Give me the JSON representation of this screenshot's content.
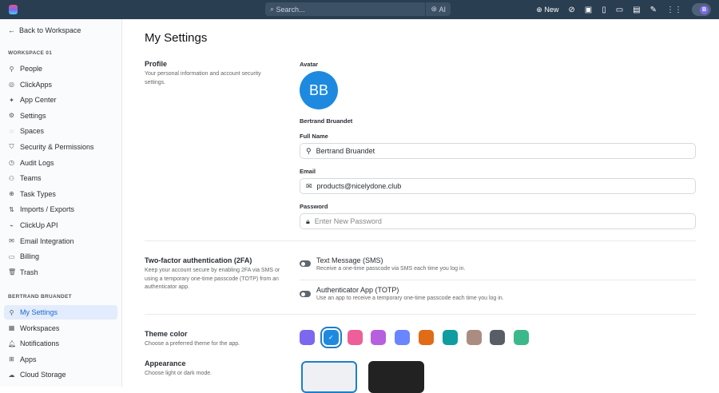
{
  "topbar": {
    "search_placeholder": "Search...",
    "ai_label": "AI",
    "new_label": "New",
    "avatar_initial": "B"
  },
  "sidebar": {
    "back": "Back to Workspace",
    "workspace_heading": "WORKSPACE 01",
    "workspace_items": [
      {
        "label": "People",
        "icon": "person-icon"
      },
      {
        "label": "ClickApps",
        "icon": "clickapps-icon"
      },
      {
        "label": "App Center",
        "icon": "app-center-icon"
      },
      {
        "label": "Settings",
        "icon": "gear-icon"
      },
      {
        "label": "Spaces",
        "icon": "spaces-icon"
      },
      {
        "label": "Security & Permissions",
        "icon": "shield-icon"
      },
      {
        "label": "Audit Logs",
        "icon": "audit-icon"
      },
      {
        "label": "Teams",
        "icon": "teams-icon"
      },
      {
        "label": "Task Types",
        "icon": "task-types-icon"
      },
      {
        "label": "Imports / Exports",
        "icon": "import-icon"
      },
      {
        "label": "ClickUp API",
        "icon": "api-icon"
      },
      {
        "label": "Email Integration",
        "icon": "email-icon"
      },
      {
        "label": "Billing",
        "icon": "billing-icon"
      },
      {
        "label": "Trash",
        "icon": "trash-icon"
      }
    ],
    "user_heading": "BERTRAND BRUANDET",
    "user_items": [
      {
        "label": "My Settings",
        "icon": "person-icon"
      },
      {
        "label": "Workspaces",
        "icon": "workspaces-icon"
      },
      {
        "label": "Notifications",
        "icon": "bell-icon"
      },
      {
        "label": "Apps",
        "icon": "apps-icon"
      },
      {
        "label": "Cloud Storage",
        "icon": "cloud-icon"
      }
    ]
  },
  "main": {
    "title": "My Settings",
    "profile": {
      "label": "Profile",
      "desc": "Your personal information and account security settings.",
      "avatar_label": "Avatar",
      "initials": "BB",
      "name": "Bertrand Bruandet",
      "full_name_label": "Full Name",
      "full_name": "Bertrand Bruandet",
      "email_label": "Email",
      "email": "products@nicelydone.club",
      "password_label": "Password",
      "password_placeholder": "Enter New Password"
    },
    "twofa": {
      "label": "Two-factor authentication (2FA)",
      "desc": "Keep your account secure by enabling 2FA via SMS or using a temporary one-time passcode (TOTP) from an authenticator app.",
      "options": [
        {
          "title": "Text Message (SMS)",
          "desc": "Receive a one-time passcode via SMS each time you log in.",
          "enabled": false
        },
        {
          "title": "Authenticator App (TOTP)",
          "desc": "Use an app to receive a temporary one-time passcode each time you log in.",
          "enabled": false
        }
      ]
    },
    "theme": {
      "label": "Theme color",
      "desc": "Choose a preferred theme for the app.",
      "colors": [
        "#7b68ee",
        "#1d8ae0",
        "#ee5e99",
        "#b660e0",
        "#6985ff",
        "#e16b16",
        "#0f9d9f",
        "#aa8d80",
        "#595d66",
        "#3db88b"
      ],
      "selected_index": 1
    },
    "appearance": {
      "label": "Appearance",
      "desc": "Choose light or dark mode."
    }
  }
}
